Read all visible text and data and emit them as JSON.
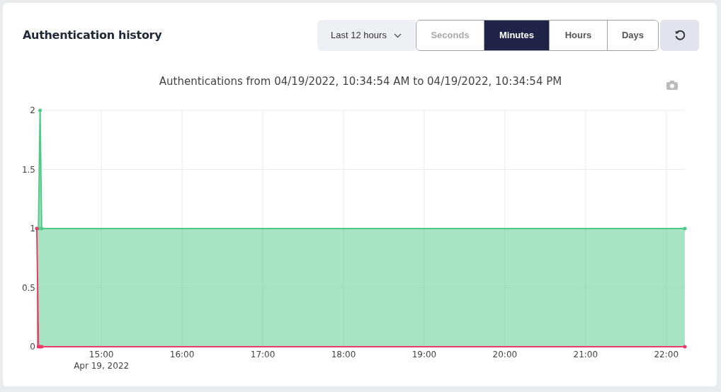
{
  "card": {
    "title": "Authentication history",
    "range_select": {
      "value": "Last 12 hours"
    },
    "granularity_tabs": [
      {
        "label": "Seconds",
        "selected": false,
        "disabled": true
      },
      {
        "label": "Minutes",
        "selected": true,
        "disabled": false
      },
      {
        "label": "Hours",
        "selected": false,
        "disabled": false
      },
      {
        "label": "Days",
        "selected": false,
        "disabled": false
      }
    ],
    "chart_data": {
      "type": "area",
      "title": "Authentications from 04/19/2022, 10:34:54 AM to 04/19/2022, 10:34:54 PM",
      "x": [
        14.2,
        14.22,
        14.24,
        14.26,
        22.23
      ],
      "series": [
        {
          "color": "#4fc987",
          "values": [
            1,
            1,
            2,
            1,
            1
          ]
        },
        {
          "color": "#ef3a68",
          "values": [
            1,
            0,
            0,
            0,
            0
          ]
        }
      ],
      "grid": true,
      "xlim": [
        14.2,
        22.23
      ],
      "ylim": [
        0,
        2
      ],
      "xticks": [
        {
          "value": 15,
          "label": "15:00"
        },
        {
          "value": 16,
          "label": "16:00"
        },
        {
          "value": 17,
          "label": "17:00"
        },
        {
          "value": 18,
          "label": "18:00"
        },
        {
          "value": 19,
          "label": "19:00"
        },
        {
          "value": 20,
          "label": "20:00"
        },
        {
          "value": 21,
          "label": "21:00"
        },
        {
          "value": 22,
          "label": "22:00"
        }
      ],
      "yticks": [
        {
          "value": 0,
          "label": "0"
        },
        {
          "value": 0.5,
          "label": "0.5"
        },
        {
          "value": 1,
          "label": "1"
        },
        {
          "value": 1.5,
          "label": "1.5"
        },
        {
          "value": 2,
          "label": "2"
        }
      ]
    },
    "x_axis_date": "Apr 19, 2022"
  }
}
